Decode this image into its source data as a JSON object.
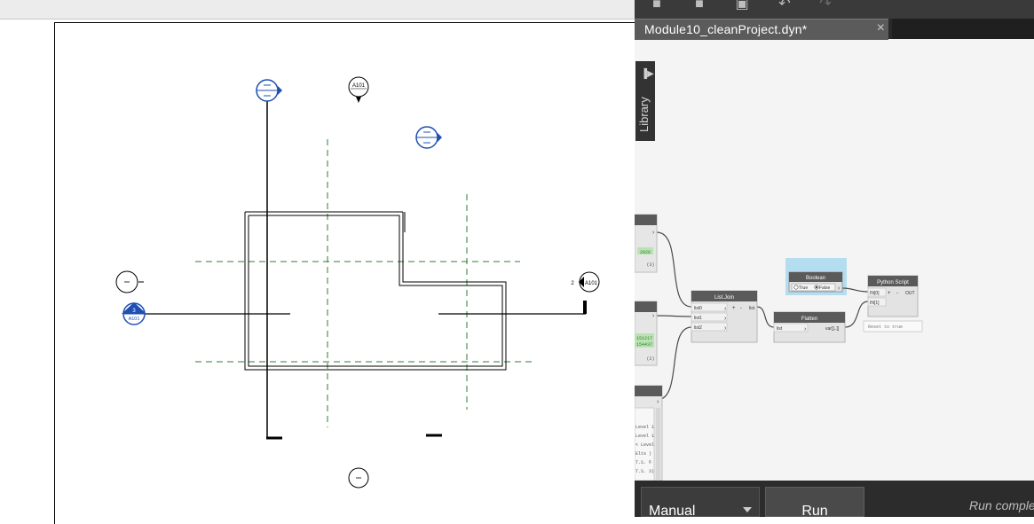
{
  "dynamo": {
    "tab_title": "Module10_cleanProject.dyn*",
    "tab_close": "×",
    "library_label": "Library",
    "toolbar_icons": [
      "new-file-icon",
      "open-file-icon",
      "save-icon",
      "undo-icon",
      "redo-icon"
    ],
    "nodes": {
      "list_join": {
        "title": "List.Join",
        "ports": [
          "list0",
          "list1",
          "list2"
        ],
        "output": "list",
        "plus": "+",
        "minus": "-"
      },
      "flatten": {
        "title": "Flatten",
        "input": "list",
        "output": "var[]..[]"
      },
      "boolean": {
        "title": "Boolean",
        "opt_true": "True",
        "opt_false": "False"
      },
      "python_script": {
        "title": "Python Script",
        "inputs": [
          "IN[0]",
          "IN[1]"
        ],
        "output": "OUT",
        "plus": "+",
        "minus": "-",
        "preview": "Reset to true"
      }
    },
    "partial_nodes": {
      "upper_values": [
        "2026",
        "(3)"
      ],
      "middle_values": [
        "151217",
        "154437",
        "(2)"
      ],
      "lower_lines": [
        "Level 1",
        "Level 1",
        "< Level",
        "Elts )",
        "T.S. ©",
        "T.S. 3)"
      ]
    },
    "run_mode": "Manual",
    "run_label": "Run",
    "run_status": "Run completed."
  },
  "revit": {
    "view_markers": {
      "top_elevation": "A101",
      "left_section_num": "3",
      "left_section_sheet": "A101",
      "right_elevation_num": "2",
      "right_elevation_sheet": "A101"
    }
  },
  "colors": {
    "accent_blue": "#1f4fb3",
    "grid_green": "#2e7d32",
    "node_header": "#5a5a5a",
    "selection": "#a8d8ee",
    "dyn_bg": "#f4f4f4"
  }
}
